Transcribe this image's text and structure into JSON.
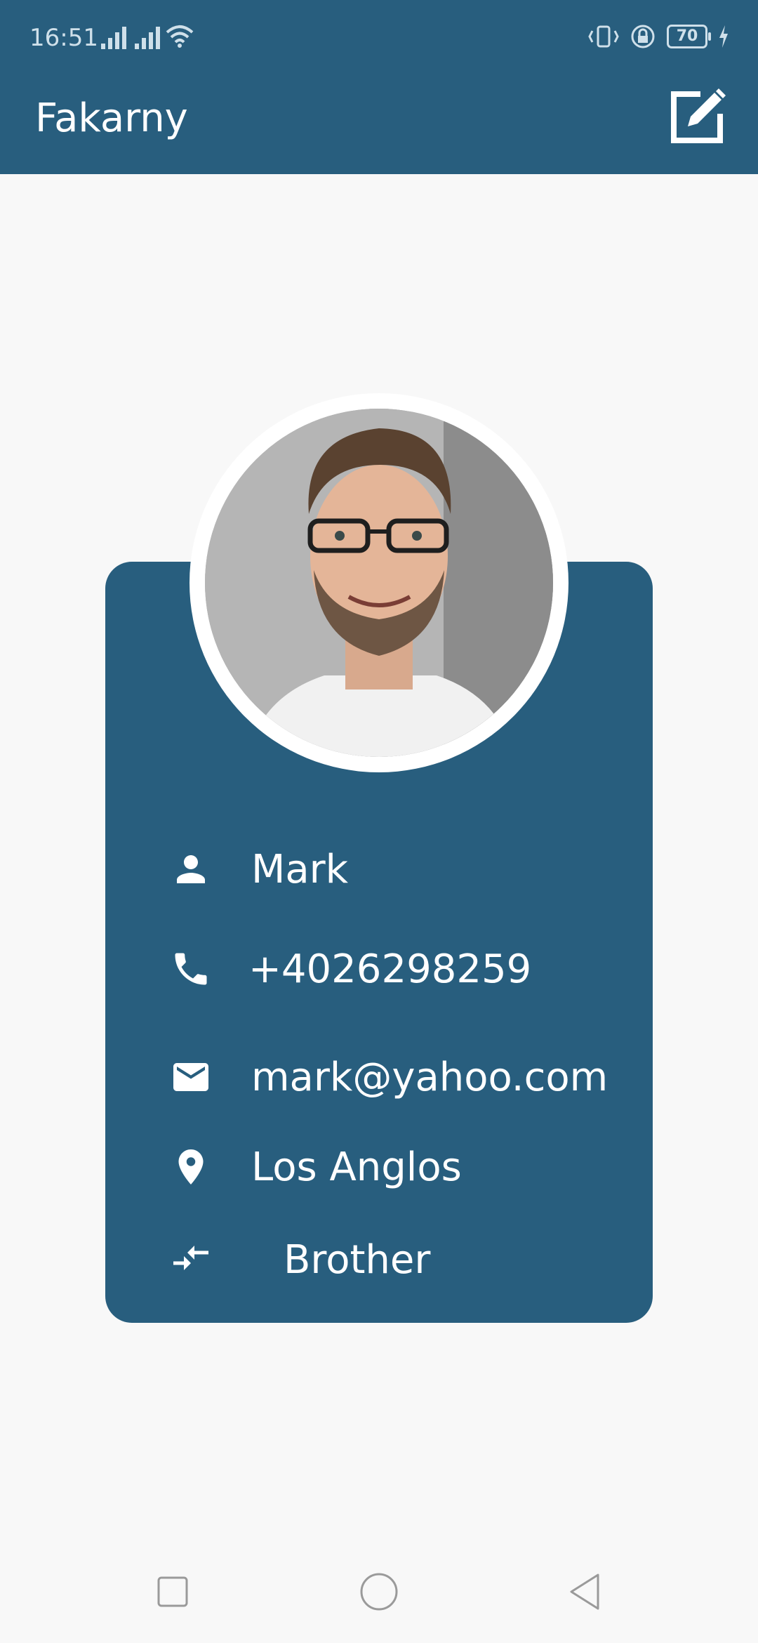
{
  "status_bar": {
    "time": "16:51",
    "battery": "70"
  },
  "app_bar": {
    "title": "Fakarny",
    "edit_icon": "edit-icon"
  },
  "contact": {
    "photo_icon": "avatar-photo",
    "name": "Mark",
    "phone": "+4026298259",
    "email": "mark@yahoo.com",
    "location": "Los Anglos",
    "relation": "Brother"
  },
  "icons": {
    "name": "person-icon",
    "phone": "phone-icon",
    "email": "mail-icon",
    "location": "location-pin-icon",
    "relation": "swap-arrows-icon"
  },
  "colors": {
    "primary": "#285e7e",
    "background": "#f8f8f8"
  },
  "nav": {
    "recent": "square-icon",
    "home": "circle-icon",
    "back": "triangle-back-icon"
  }
}
